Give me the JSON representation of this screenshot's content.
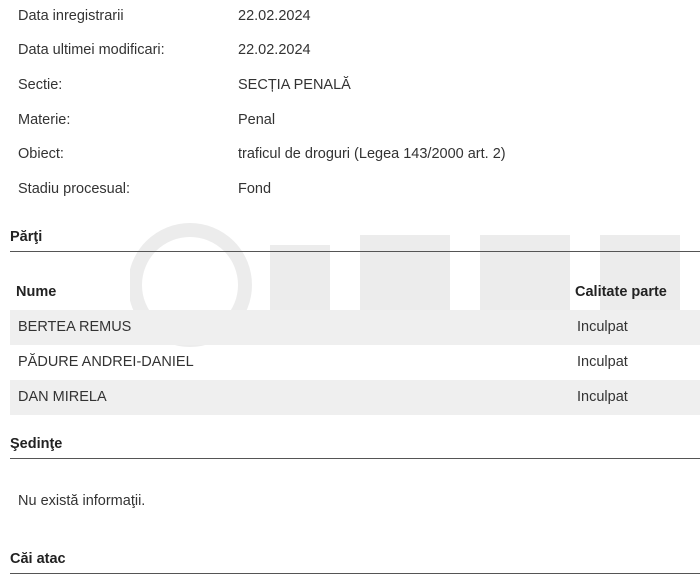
{
  "details": [
    {
      "label": "Data inregistrarii",
      "value": "22.02.2024"
    },
    {
      "label": "Data ultimei modificari:",
      "value": "22.02.2024"
    },
    {
      "label": "Sectie:",
      "value": "SECȚIA PENALĂ"
    },
    {
      "label": "Materie:",
      "value": "Penal"
    },
    {
      "label": "Obiect:",
      "value": "traficul de droguri (Legea 143/2000 art. 2)"
    },
    {
      "label": "Stadiu procesual:",
      "value": "Fond"
    }
  ],
  "parti": {
    "title": "Părţi",
    "columns": {
      "name": "Nume",
      "role": "Calitate parte"
    },
    "rows": [
      {
        "name": "BERTEA REMUS",
        "role": "Inculpat"
      },
      {
        "name": "PĂDURE ANDREI-DANIEL",
        "role": "Inculpat"
      },
      {
        "name": "DAN MIRELA",
        "role": "Inculpat"
      }
    ]
  },
  "sedinte": {
    "title": "Şedinţe",
    "message": "Nu există informaţii."
  },
  "cai_atac": {
    "title": "Căi atac"
  }
}
